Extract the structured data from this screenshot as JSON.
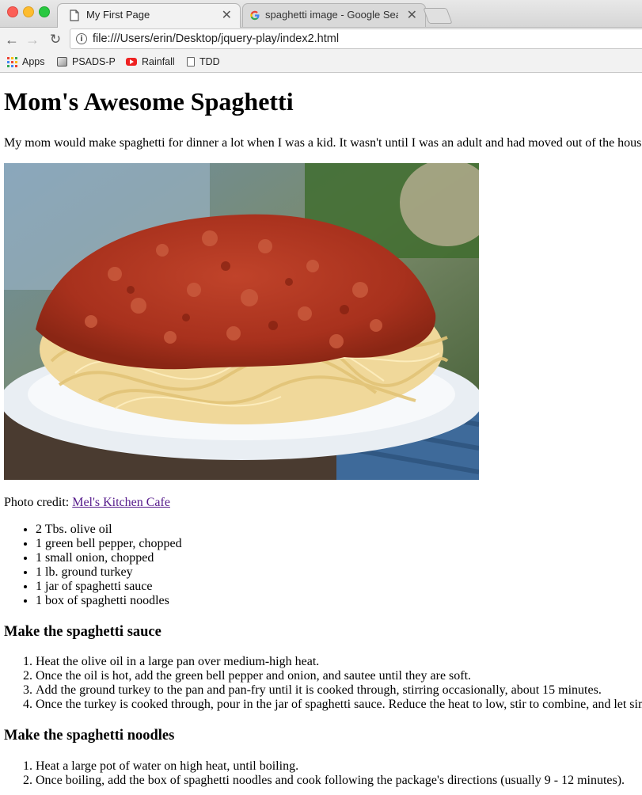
{
  "browser": {
    "tabs": [
      {
        "title": "My First Page",
        "active": true
      },
      {
        "title": "spaghetti image - Google Search",
        "active": false
      }
    ],
    "address": "file:///Users/erin/Desktop/jquery-play/index2.html",
    "bookmarks": [
      "Apps",
      "PSADS-P",
      "Rainfall",
      "TDD"
    ],
    "icons": {
      "back": "back-arrow-icon",
      "forward": "forward-arrow-icon",
      "reload": "reload-icon",
      "info": "info-icon",
      "close": "close-icon"
    }
  },
  "page": {
    "title": "Mom's Awesome Spaghetti",
    "intro": "My mom would make spaghetti for dinner a lot when I was a kid. It wasn't until I was an adult and had moved out of the house",
    "photo_credit_label": "Photo credit: ",
    "photo_credit_link": "Mel's Kitchen Cafe",
    "ingredients": [
      "2 Tbs. olive oil",
      "1 green bell pepper, chopped",
      "1 small onion, chopped",
      "1 lb. ground turkey",
      "1 jar of spaghetti sauce",
      "1 box of spaghetti noodles"
    ],
    "sauce_heading": "Make the spaghetti sauce",
    "sauce_steps": [
      "Heat the olive oil in a large pan over medium-high heat.",
      "Once the oil is hot, add the green bell pepper and onion, and sautee until they are soft.",
      "Add the ground turkey to the pan and pan-fry until it is cooked through, stirring occasionally, about 15 minutes.",
      "Once the turkey is cooked through, pour in the jar of spaghetti sauce. Reduce the heat to low, stir to combine, and let simmer"
    ],
    "noodles_heading": "Make the spaghetti noodles",
    "noodle_steps": [
      "Heat a large pot of water on high heat, until boiling.",
      "Once boiling, add the box of spaghetti noodles and cook following the package's directions (usually 9 - 12 minutes)."
    ]
  }
}
